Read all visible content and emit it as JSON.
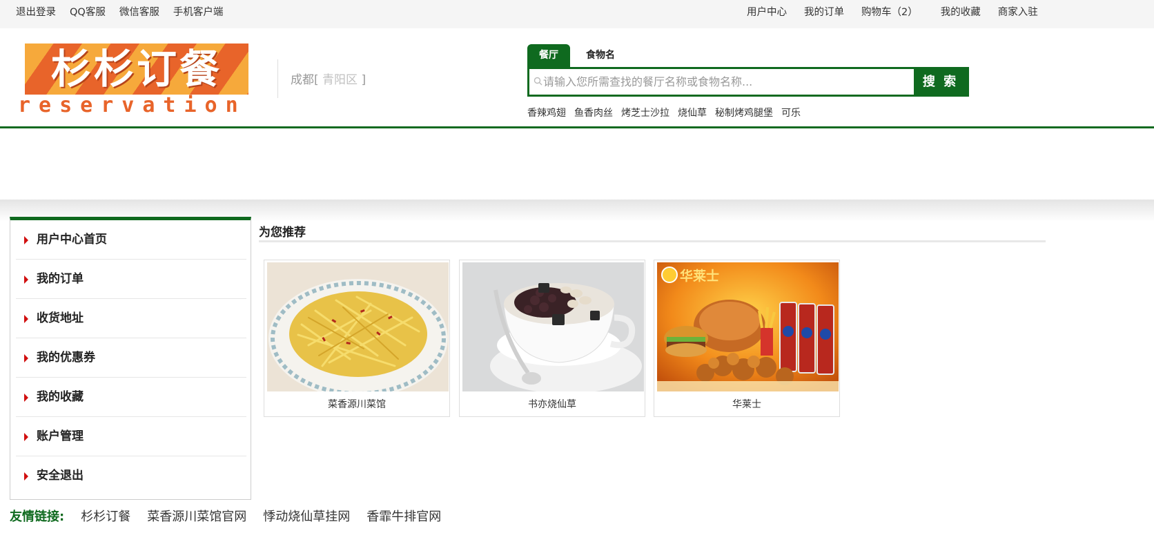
{
  "topbar": {
    "left_links": [
      "退出登录",
      "QQ客服",
      "微信客服",
      "手机客户端"
    ],
    "user_center": "用户中心",
    "my_orders": "我的订单",
    "cart": "购物车（2）",
    "favorites": "我的收藏",
    "merchant": "商家入驻"
  },
  "logo": {
    "title": "杉杉订餐",
    "subtitle": "reservation"
  },
  "location": {
    "city": "成都[",
    "district": " 青阳区 ",
    "close": "]"
  },
  "search": {
    "tab_active": "餐厅",
    "tab_inactive": "食物名",
    "placeholder": "请输入您所需查找的餐厅名称或食物名称...",
    "button": "搜 索",
    "hot_words": [
      "香辣鸡翅",
      "鱼香肉丝",
      "烤芝士沙拉",
      "烧仙草",
      "秘制烤鸡腿堡",
      "可乐"
    ]
  },
  "sidebar": {
    "items": [
      "用户中心首页",
      "我的订单",
      "收货地址",
      "我的优惠券",
      "我的收藏",
      "账户管理",
      "安全退出"
    ]
  },
  "recommend": {
    "title": "为您推荐",
    "cards": [
      {
        "name": "菜香源川菜馆"
      },
      {
        "name": "书亦烧仙草"
      },
      {
        "name": "华莱士",
        "brand": "华莱士"
      }
    ]
  },
  "friends": {
    "label": "友情链接:",
    "links": [
      "杉杉订餐",
      "菜香源川菜馆官网",
      "悸动烧仙草挂网",
      "香霏牛排官网"
    ]
  },
  "colors": {
    "brand_green": "#0f6a1f",
    "arrow_red": "#d10f0f",
    "logo_orange": "#e8642a"
  }
}
